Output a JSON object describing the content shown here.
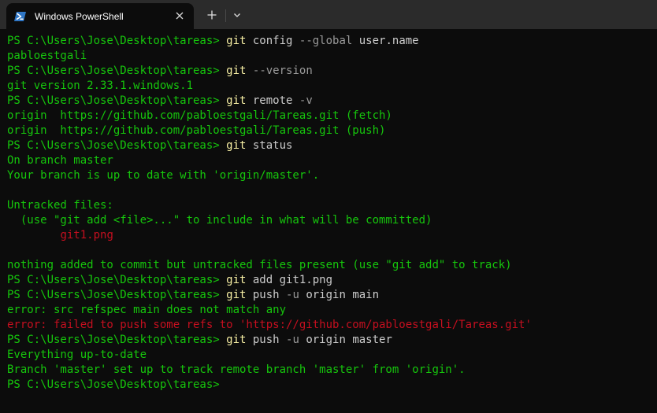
{
  "window": {
    "tab_title": "Windows PowerShell",
    "tab_icon": "powershell-icon",
    "close_icon": "close-icon",
    "new_tab_icon": "plus-icon",
    "dropdown_icon": "chevron-down-icon"
  },
  "colors": {
    "prompt": "#16c60c",
    "command": "#f9f1a5",
    "argument": "#cccccc",
    "flag": "#9a9a9a",
    "output_green": "#16c60c",
    "output_red": "#e74856",
    "error_red": "#c50f1f",
    "background": "#0c0c0c",
    "titlebar": "#2b2b2b"
  },
  "terminal": {
    "lines": [
      [
        {
          "t": "PS C:\\Users\\Jose\\Desktop\\tareas> ",
          "c": "g"
        },
        {
          "t": "git",
          "c": "y"
        },
        {
          "t": " config ",
          "c": "w"
        },
        {
          "t": "--global",
          "c": "gr"
        },
        {
          "t": " user.name",
          "c": "w"
        }
      ],
      [
        {
          "t": "pabloestgali",
          "c": "g"
        }
      ],
      [
        {
          "t": "PS C:\\Users\\Jose\\Desktop\\tareas> ",
          "c": "g"
        },
        {
          "t": "git",
          "c": "y"
        },
        {
          "t": " ",
          "c": "w"
        },
        {
          "t": "--version",
          "c": "gr"
        }
      ],
      [
        {
          "t": "git version 2.33.1.windows.1",
          "c": "g"
        }
      ],
      [
        {
          "t": "PS C:\\Users\\Jose\\Desktop\\tareas> ",
          "c": "g"
        },
        {
          "t": "git",
          "c": "y"
        },
        {
          "t": " remote ",
          "c": "w"
        },
        {
          "t": "-v",
          "c": "gr"
        }
      ],
      [
        {
          "t": "origin  https://github.com/pabloestgali/Tareas.git (fetch)",
          "c": "g"
        }
      ],
      [
        {
          "t": "origin  https://github.com/pabloestgali/Tareas.git (push)",
          "c": "g"
        }
      ],
      [
        {
          "t": "PS C:\\Users\\Jose\\Desktop\\tareas> ",
          "c": "g"
        },
        {
          "t": "git",
          "c": "y"
        },
        {
          "t": " status",
          "c": "w"
        }
      ],
      [
        {
          "t": "On branch master",
          "c": "g"
        }
      ],
      [
        {
          "t": "Your branch is up to date with 'origin/master'.",
          "c": "g"
        }
      ],
      [
        {
          "t": "",
          "c": "g"
        }
      ],
      [
        {
          "t": "Untracked files:",
          "c": "g"
        }
      ],
      [
        {
          "t": "  (use \"git add <file>...\" to include in what will be committed)",
          "c": "g"
        }
      ],
      [
        {
          "t": "        ",
          "c": "w"
        },
        {
          "t": "git1.png",
          "c": "r2"
        }
      ],
      [
        {
          "t": "",
          "c": "g"
        }
      ],
      [
        {
          "t": "nothing added to commit but untracked files present (use \"git add\" to track)",
          "c": "g"
        }
      ],
      [
        {
          "t": "PS C:\\Users\\Jose\\Desktop\\tareas> ",
          "c": "g"
        },
        {
          "t": "git",
          "c": "y"
        },
        {
          "t": " add git1.png",
          "c": "w"
        }
      ],
      [
        {
          "t": "PS C:\\Users\\Jose\\Desktop\\tareas> ",
          "c": "g"
        },
        {
          "t": "git",
          "c": "y"
        },
        {
          "t": " push ",
          "c": "w"
        },
        {
          "t": "-u",
          "c": "gr"
        },
        {
          "t": " origin main",
          "c": "w"
        }
      ],
      [
        {
          "t": "error: src refspec main does not match any",
          "c": "g"
        }
      ],
      [
        {
          "t": "error: failed to push some refs to 'https://github.com/pabloestgali/Tareas.git'",
          "c": "r2"
        }
      ],
      [
        {
          "t": "PS C:\\Users\\Jose\\Desktop\\tareas> ",
          "c": "g"
        },
        {
          "t": "git",
          "c": "y"
        },
        {
          "t": " push ",
          "c": "w"
        },
        {
          "t": "-u",
          "c": "gr"
        },
        {
          "t": " origin master",
          "c": "w"
        }
      ],
      [
        {
          "t": "Everything up-to-date",
          "c": "g"
        }
      ],
      [
        {
          "t": "Branch 'master' set up to track remote branch 'master' from 'origin'.",
          "c": "g"
        }
      ],
      [
        {
          "t": "PS C:\\Users\\Jose\\Desktop\\tareas>",
          "c": "g"
        }
      ]
    ]
  }
}
